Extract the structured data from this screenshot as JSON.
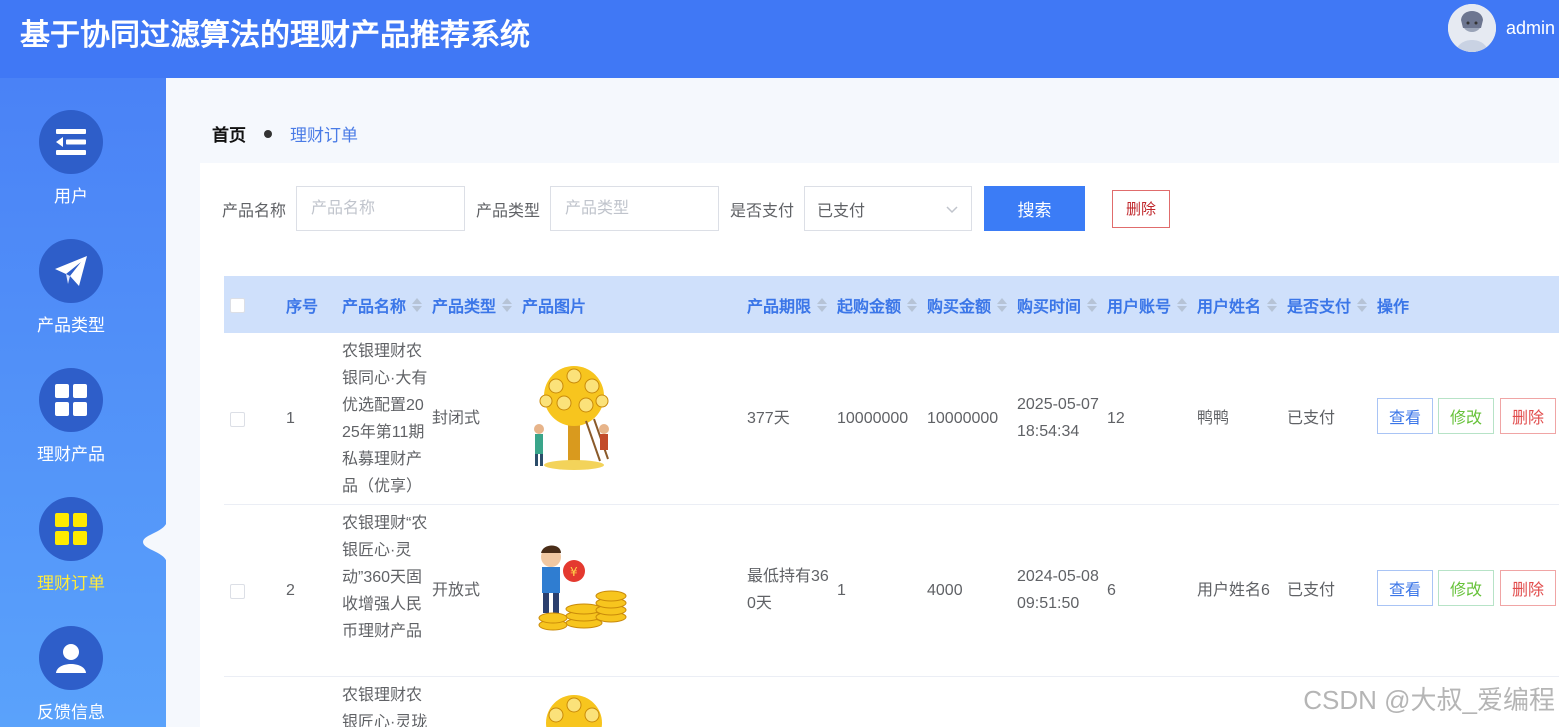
{
  "app": {
    "title": "基于协同过滤算法的理财产品推荐系统",
    "username": "admin"
  },
  "sidebar": {
    "items": [
      {
        "label": "用户",
        "icon": "list-icon"
      },
      {
        "label": "产品类型",
        "icon": "paper-plane-icon"
      },
      {
        "label": "理财产品",
        "icon": "grid-icon"
      },
      {
        "label": "理财订单",
        "icon": "grid-icon",
        "active": true
      },
      {
        "label": "反馈信息",
        "icon": "user-icon"
      }
    ],
    "active_color": "#ffeb3b"
  },
  "breadcrumb": {
    "home": "首页",
    "current": "理财订单"
  },
  "search": {
    "product_name_label": "产品名称",
    "product_name_placeholder": "产品名称",
    "product_type_label": "产品类型",
    "product_type_placeholder": "产品类型",
    "paid_label": "是否支付",
    "paid_value": "已支付",
    "search_button": "搜索",
    "delete_button": "删除"
  },
  "table": {
    "columns": [
      "序号",
      "产品名称",
      "产品类型",
      "产品图片",
      "产品期限",
      "起购金额",
      "购买金额",
      "购买时间",
      "用户账号",
      "用户姓名",
      "是否支付",
      "操作"
    ],
    "rows": [
      {
        "index": "1",
        "name": "农银理财农银同心·大有优选配置2025年第11期私募理财产品（优享）",
        "type": "封闭式",
        "image": "money-tree-image",
        "term": "377天",
        "min_amount": "10000000",
        "amount": "10000000",
        "time": "2025-05-07 18:54:34",
        "account": "12",
        "user_name": "鸭鸭",
        "paid": "已支付"
      },
      {
        "index": "2",
        "name": "农银理财“农银匠心·灵动”360天固收增强人民币理财产品",
        "type": "开放式",
        "image": "coins-person-image",
        "term": "最低持有360天",
        "min_amount": "1",
        "amount": "4000",
        "time": "2024-05-08 09:51:50",
        "account": "6",
        "user_name": "用户姓名6",
        "paid": "已支付"
      },
      {
        "index": "",
        "name": "农银理财农银匠心·灵珑",
        "image": "money-tree-image"
      }
    ],
    "actions": {
      "view": "查看",
      "edit": "修改",
      "delete": "删除"
    }
  },
  "watermark": "CSDN @大叔_爱编程",
  "colors": {
    "header": "#4078f5",
    "primary": "#3b7cf6",
    "table_header": "#cfe0fb",
    "danger": "#e14b4b",
    "success": "#67c23a"
  }
}
